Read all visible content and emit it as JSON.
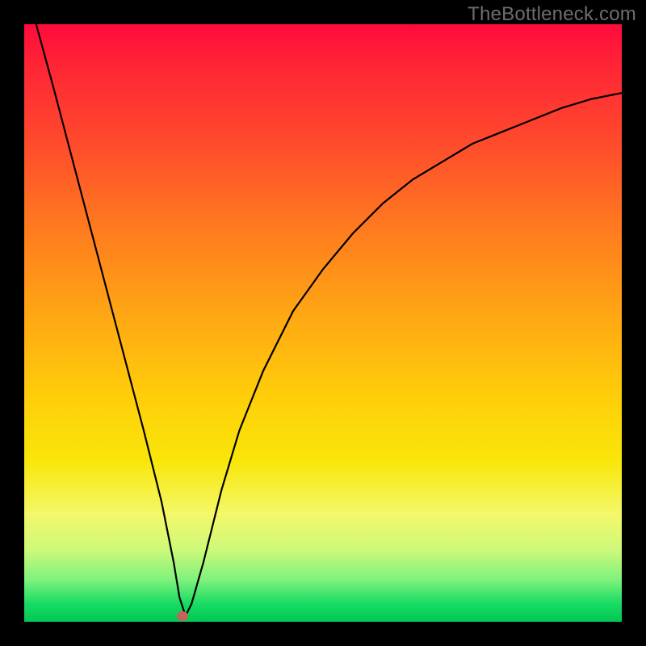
{
  "watermark": "TheBottleneck.com",
  "chart_data": {
    "type": "line",
    "title": "",
    "xlabel": "",
    "ylabel": "",
    "xlim": [
      0,
      100
    ],
    "ylim": [
      0,
      100
    ],
    "grid": false,
    "legend": false,
    "series": [
      {
        "name": "bottleneck-curve",
        "x": [
          2,
          5,
          10,
          15,
          20,
          23,
          25,
          26,
          27,
          28,
          30,
          33,
          36,
          40,
          45,
          50,
          55,
          60,
          65,
          70,
          75,
          80,
          85,
          90,
          95,
          100
        ],
        "y": [
          100,
          89,
          70,
          51,
          32,
          20,
          10,
          4,
          1,
          3,
          10,
          22,
          32,
          42,
          52,
          59,
          65,
          70,
          74,
          77,
          80,
          82,
          84,
          86,
          87.5,
          88.5
        ]
      }
    ],
    "annotations": [
      {
        "name": "minimum-point",
        "x": 26.5,
        "y": 1
      }
    ],
    "background_gradient": {
      "top": "#ff0a3c",
      "mid1": "#ffa514",
      "mid2": "#f4f86a",
      "bottom": "#00c853"
    }
  }
}
